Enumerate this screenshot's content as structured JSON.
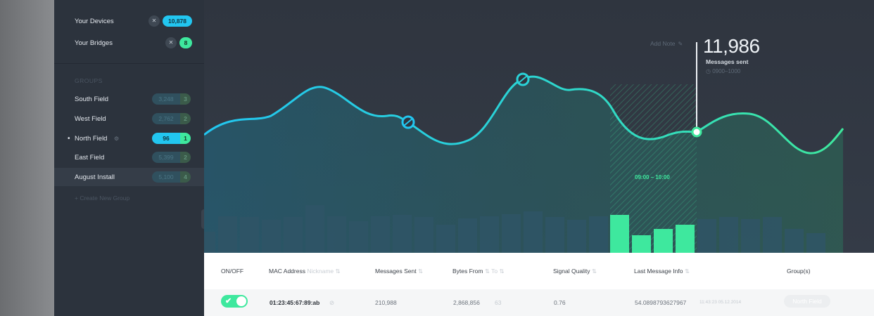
{
  "sidebar": {
    "summary": [
      {
        "label": "Your Devices",
        "count": "10,878",
        "color": "#22c6f0"
      },
      {
        "label": "Your Bridges",
        "count": "8",
        "color": "#3ee89e"
      }
    ],
    "groups_title": "GROUPS",
    "groups": [
      {
        "label": "South Field",
        "value": "3,248",
        "count": "3"
      },
      {
        "label": "West Field",
        "value": "2,762",
        "count": "2"
      },
      {
        "label": "North Field",
        "value": "96",
        "count": "1",
        "active": true
      },
      {
        "label": "East Field",
        "value": "5,399",
        "count": "2"
      },
      {
        "label": "August Install",
        "value": "5,100",
        "count": "4",
        "highlighted": true
      }
    ],
    "create_group": "+ Create New Group"
  },
  "chart": {
    "tooltip_value": "11,986",
    "tooltip_label": "Messages sent",
    "tooltip_range": "◷ 0900–1000",
    "add_note": "Add Note",
    "range_label": "09:00 – 10:00",
    "accent_blue": "#22c6f0",
    "accent_green": "#3ee89e"
  },
  "table": {
    "headers": {
      "onoff": "ON/OFF",
      "mac": "MAC Address",
      "nickname": "Nickname",
      "messages": "Messages Sent",
      "bytes_from": "Bytes From",
      "bytes_to": "To",
      "signal": "Signal Quality",
      "last_msg": "Last Message Info",
      "groups": "Group(s)"
    },
    "row": {
      "mac": "01:23:45:67:89:ab",
      "messages": "210,988",
      "bytes_from": "2,868,856",
      "bytes_to": "63",
      "signal": "0.76",
      "last_msg": "54.0898793627967",
      "last_msg_time": "11:43:23 05.12.2014",
      "group": "North Field"
    }
  }
}
